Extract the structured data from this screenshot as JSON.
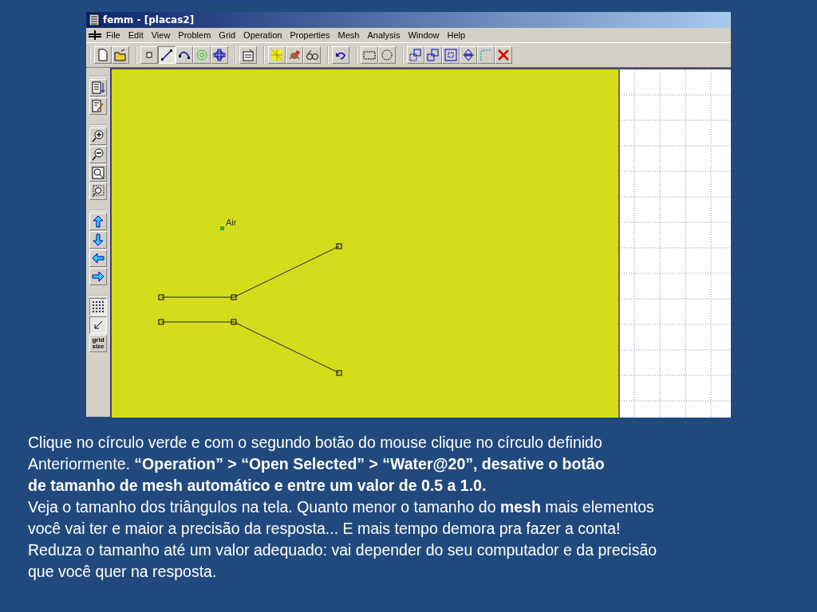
{
  "window": {
    "title": "femm - [placas2]"
  },
  "menu": [
    "File",
    "Edit",
    "View",
    "Problem",
    "Grid",
    "Operation",
    "Properties",
    "Mesh",
    "Analysis",
    "Window",
    "Help"
  ],
  "toolbar": [
    [
      {
        "kind": "new",
        "pressed": false
      },
      {
        "kind": "open",
        "pressed": false
      }
    ],
    [
      {
        "kind": "node",
        "pressed": false
      },
      {
        "kind": "segment",
        "pressed": true
      },
      {
        "kind": "arc",
        "pressed": false
      },
      {
        "kind": "block",
        "pressed": false
      },
      {
        "kind": "group",
        "pressed": false
      }
    ],
    [
      {
        "kind": "props",
        "pressed": false
      }
    ],
    [
      {
        "kind": "mesh",
        "pressed": false
      },
      {
        "kind": "bug",
        "pressed": false
      },
      {
        "kind": "glasses",
        "pressed": false
      }
    ],
    [
      {
        "kind": "undo",
        "pressed": false
      }
    ],
    [
      {
        "kind": "rectsel",
        "pressed": false
      },
      {
        "kind": "circsel",
        "pressed": false
      }
    ],
    [
      {
        "kind": "move",
        "pressed": false
      },
      {
        "kind": "copy",
        "pressed": false
      },
      {
        "kind": "scale",
        "pressed": false
      },
      {
        "kind": "mirror",
        "pressed": false
      },
      {
        "kind": "fillet",
        "pressed": false
      },
      {
        "kind": "delete",
        "pressed": false
      }
    ]
  ],
  "side_toolbar": [
    [
      {
        "kind": "list",
        "pressed": false
      },
      {
        "kind": "edit",
        "pressed": false
      }
    ],
    [
      {
        "kind": "zoomin",
        "pressed": false
      },
      {
        "kind": "zoomout",
        "pressed": false
      },
      {
        "kind": "zoomfit",
        "pressed": false
      },
      {
        "kind": "zoomwin",
        "pressed": false
      }
    ],
    [
      {
        "kind": "up",
        "pressed": false
      },
      {
        "kind": "down",
        "pressed": false
      },
      {
        "kind": "left",
        "pressed": false
      },
      {
        "kind": "right",
        "pressed": false
      }
    ],
    [
      {
        "kind": "grid",
        "pressed": true
      },
      {
        "kind": "snap",
        "pressed": true
      },
      {
        "kind": "gridsize",
        "pressed": false,
        "label": "grid size"
      }
    ]
  ],
  "canvas": {
    "region_label": "Air"
  },
  "caption": [
    "Clique no círculo verde e com o segundo botão do mouse clique no círculo definido",
    "Anteriormente. **“Operation” > “Open Selected” > “Water@20”, desative o botão**",
    "**de tamanho de mesh automático e entre um valor de 0.5 a 1.0.**",
    "Veja o tamanho dos triângulos na tela. Quanto menor o tamanho do **mesh** mais elementos",
    "você vai ter e maior a precisão da resposta... E mais tempo demora pra fazer a conta!",
    "Reduza o tamanho até um valor adequado: vai depender do seu computador e da precisão",
    "que você quer na resposta."
  ]
}
